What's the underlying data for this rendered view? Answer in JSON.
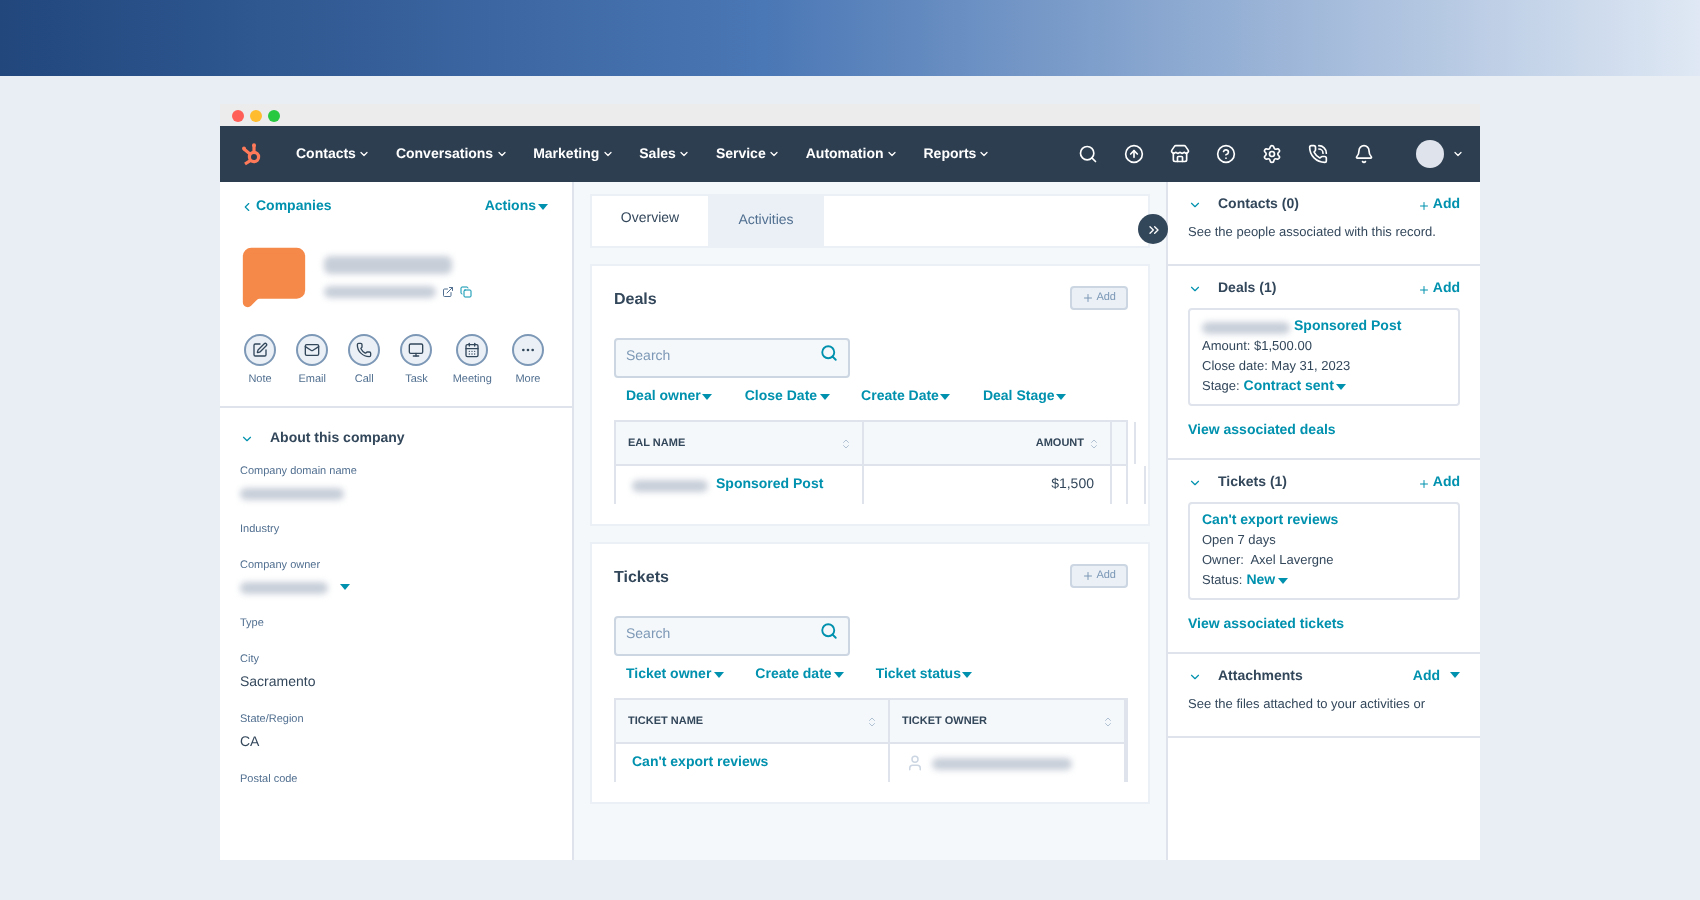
{
  "browser": {
    "dots": [
      {
        "color": "#ff5f57"
      },
      {
        "color": "#febc2e"
      },
      {
        "color": "#28c840"
      }
    ]
  },
  "nav": {
    "items": [
      "Contacts",
      "Conversations",
      "Marketing",
      "Sales",
      "Service",
      "Automation",
      "Reports"
    ]
  },
  "left": {
    "back_link": "Companies",
    "actions": "Actions",
    "activity_buttons": [
      {
        "kind": "note",
        "label": "Note"
      },
      {
        "kind": "email",
        "label": "Email"
      },
      {
        "kind": "call",
        "label": "Call"
      },
      {
        "kind": "task",
        "label": "Task"
      },
      {
        "kind": "meeting",
        "label": "Meeting"
      },
      {
        "kind": "more",
        "label": "More"
      }
    ],
    "about": {
      "title": "About this company",
      "expanded": true
    },
    "fields": [
      {
        "label": "Company domain name",
        "kind": "blurred"
      },
      {
        "label": "Industry",
        "kind": "empty"
      },
      {
        "label": "Company owner",
        "kind": "blurred_select"
      },
      {
        "label": "Type",
        "kind": "empty"
      },
      {
        "label": "City",
        "kind": "text",
        "value": "Sacramento"
      },
      {
        "label": "State/Region",
        "kind": "text",
        "value": "CA"
      },
      {
        "label": "Postal code",
        "kind": "empty"
      }
    ]
  },
  "tabs": [
    {
      "label": "Overview",
      "selected": true
    },
    {
      "label": "Activities",
      "selected": false
    }
  ],
  "deals": {
    "title": "Deals",
    "add": "Add",
    "search": {
      "placeholder": "Search"
    },
    "filters": [
      "Deal owner",
      "Close Date",
      "Create Date",
      "Deal Stage"
    ],
    "columns": [
      "EAL NAME",
      "AMOUNT"
    ],
    "rows": [
      {
        "name": "Sponsored Post",
        "amount": "$1,500"
      }
    ]
  },
  "tickets": {
    "title": "Tickets",
    "add": "Add",
    "search": {
      "placeholder": "Search"
    },
    "filters": [
      "Ticket owner",
      "Create date",
      "Ticket status"
    ],
    "columns": [
      "TICKET NAME",
      "TICKET OWNER"
    ],
    "rows": [
      {
        "name": "Can't export reviews"
      }
    ]
  },
  "sidebar": [
    {
      "kind": "text",
      "title": "Contacts (0)",
      "action": "Add",
      "expanded": true,
      "description": "See the people associated with this record."
    },
    {
      "kind": "card",
      "title": "Deals (1)",
      "action": "Add",
      "expanded": true,
      "card": {
        "name": "Sponsored Post",
        "blurred_prefix": true,
        "lines": [
          "Amount: $1,500.00",
          "Close date: May 31, 2023"
        ],
        "status_label": "Stage:",
        "status_value": "Contract sent"
      },
      "link": "View associated deals"
    },
    {
      "kind": "card",
      "title": "Tickets (1)",
      "action": "Add",
      "expanded": true,
      "card": {
        "name": "Can't export reviews",
        "blurred_prefix": false,
        "lines": [
          "Open 7 days",
          "Owner:  Axel Lavergne"
        ],
        "status_label": "Status:",
        "status_value": "New"
      },
      "link": "View associated tickets"
    },
    {
      "kind": "dropdown",
      "title": "Attachments",
      "action": "Add",
      "expanded": true,
      "description": "See the files attached to your activities or"
    }
  ]
}
